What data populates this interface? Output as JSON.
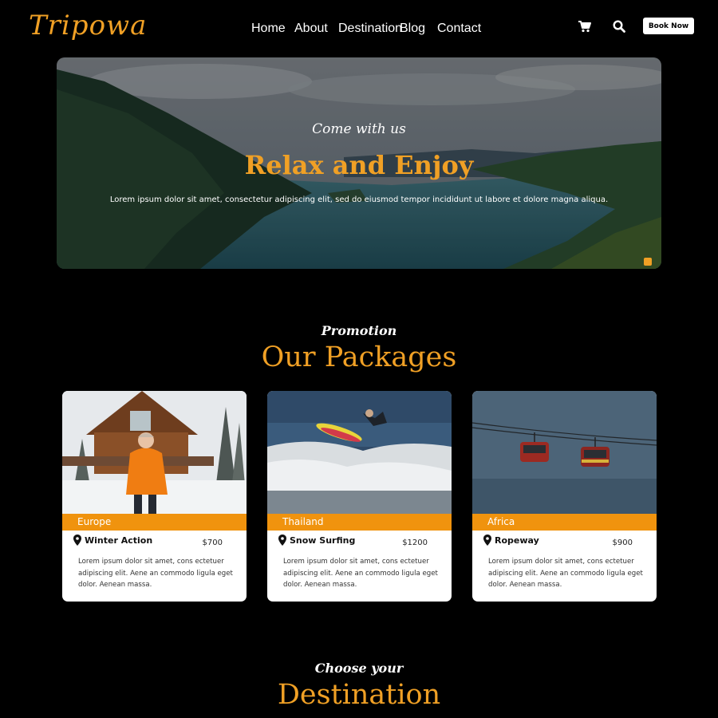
{
  "brand": {
    "logo": "Tripowa"
  },
  "nav": {
    "items": [
      {
        "label": "Home",
        "active": true
      },
      {
        "label": "About",
        "active": false
      },
      {
        "label": "Destination",
        "active": false
      },
      {
        "label": "Blog",
        "active": false
      },
      {
        "label": "Contact",
        "active": false
      }
    ],
    "cart_icon": "cart-icon",
    "search_icon": "search-icon",
    "book_label": "Book Now"
  },
  "hero": {
    "subtitle": "Come with us",
    "title": "Relax and Enjoy",
    "text": "Lorem ipsum dolor sit amet, consectetur adipiscing elit, sed do eiusmod tempor incididunt ut labore et dolore magna aliqua."
  },
  "packages": {
    "subtitle": "Promotion",
    "title": "Our Packages",
    "cards": [
      {
        "region": "Europe",
        "name": "Winter Action",
        "price": "$700",
        "description": "Lorem ipsum dolor sit amet, cons ectetuer adipiscing elit. Aene an commodo ligula eget dolor. Aenean massa."
      },
      {
        "region": "Thailand",
        "name": "Snow Surfing",
        "price": "$1200",
        "description": "Lorem ipsum dolor sit amet, cons ectetuer adipiscing elit. Aene an commodo ligula eget dolor. Aenean massa."
      },
      {
        "region": "Africa",
        "name": "Ropeway",
        "price": "$900",
        "description": "Lorem ipsum dolor sit amet, cons ectetuer adipiscing elit. Aene an commodo ligula eget dolor. Aenean massa."
      }
    ]
  },
  "destination": {
    "subtitle": "Choose your",
    "title": "Destination"
  },
  "colors": {
    "accent": "#f0a025",
    "region_bar": "#f0930e",
    "background": "#000000"
  }
}
